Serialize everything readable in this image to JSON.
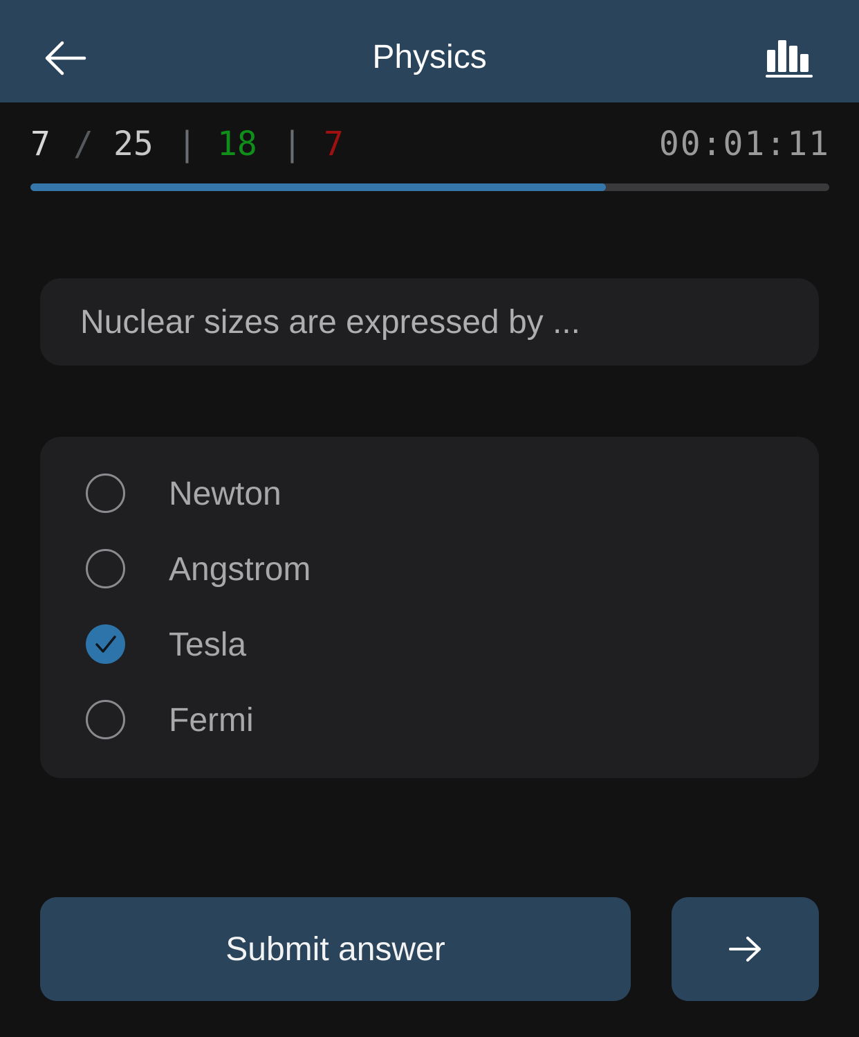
{
  "header": {
    "title": "Physics",
    "back_icon": "arrow-left-icon",
    "stats_icon": "bar-chart-icon",
    "background": "#2a445c"
  },
  "progress": {
    "current": "7",
    "separator_slash": "/",
    "total": "25",
    "separator": "|",
    "correct": "18",
    "wrong": "7",
    "timer": "00:01:11",
    "fraction_complete": 0.72,
    "colors": {
      "correct": "#0f8e1a",
      "wrong": "#9f1010",
      "bar": "#3577ab"
    }
  },
  "question": {
    "text": "Nuclear sizes are expressed by ..."
  },
  "options": [
    {
      "label": "Newton",
      "selected": false
    },
    {
      "label": "Angstrom",
      "selected": false
    },
    {
      "label": "Tesla",
      "selected": true
    },
    {
      "label": "Fermi",
      "selected": false
    }
  ],
  "actions": {
    "submit_label": "Submit answer",
    "next_icon": "arrow-right-icon"
  }
}
